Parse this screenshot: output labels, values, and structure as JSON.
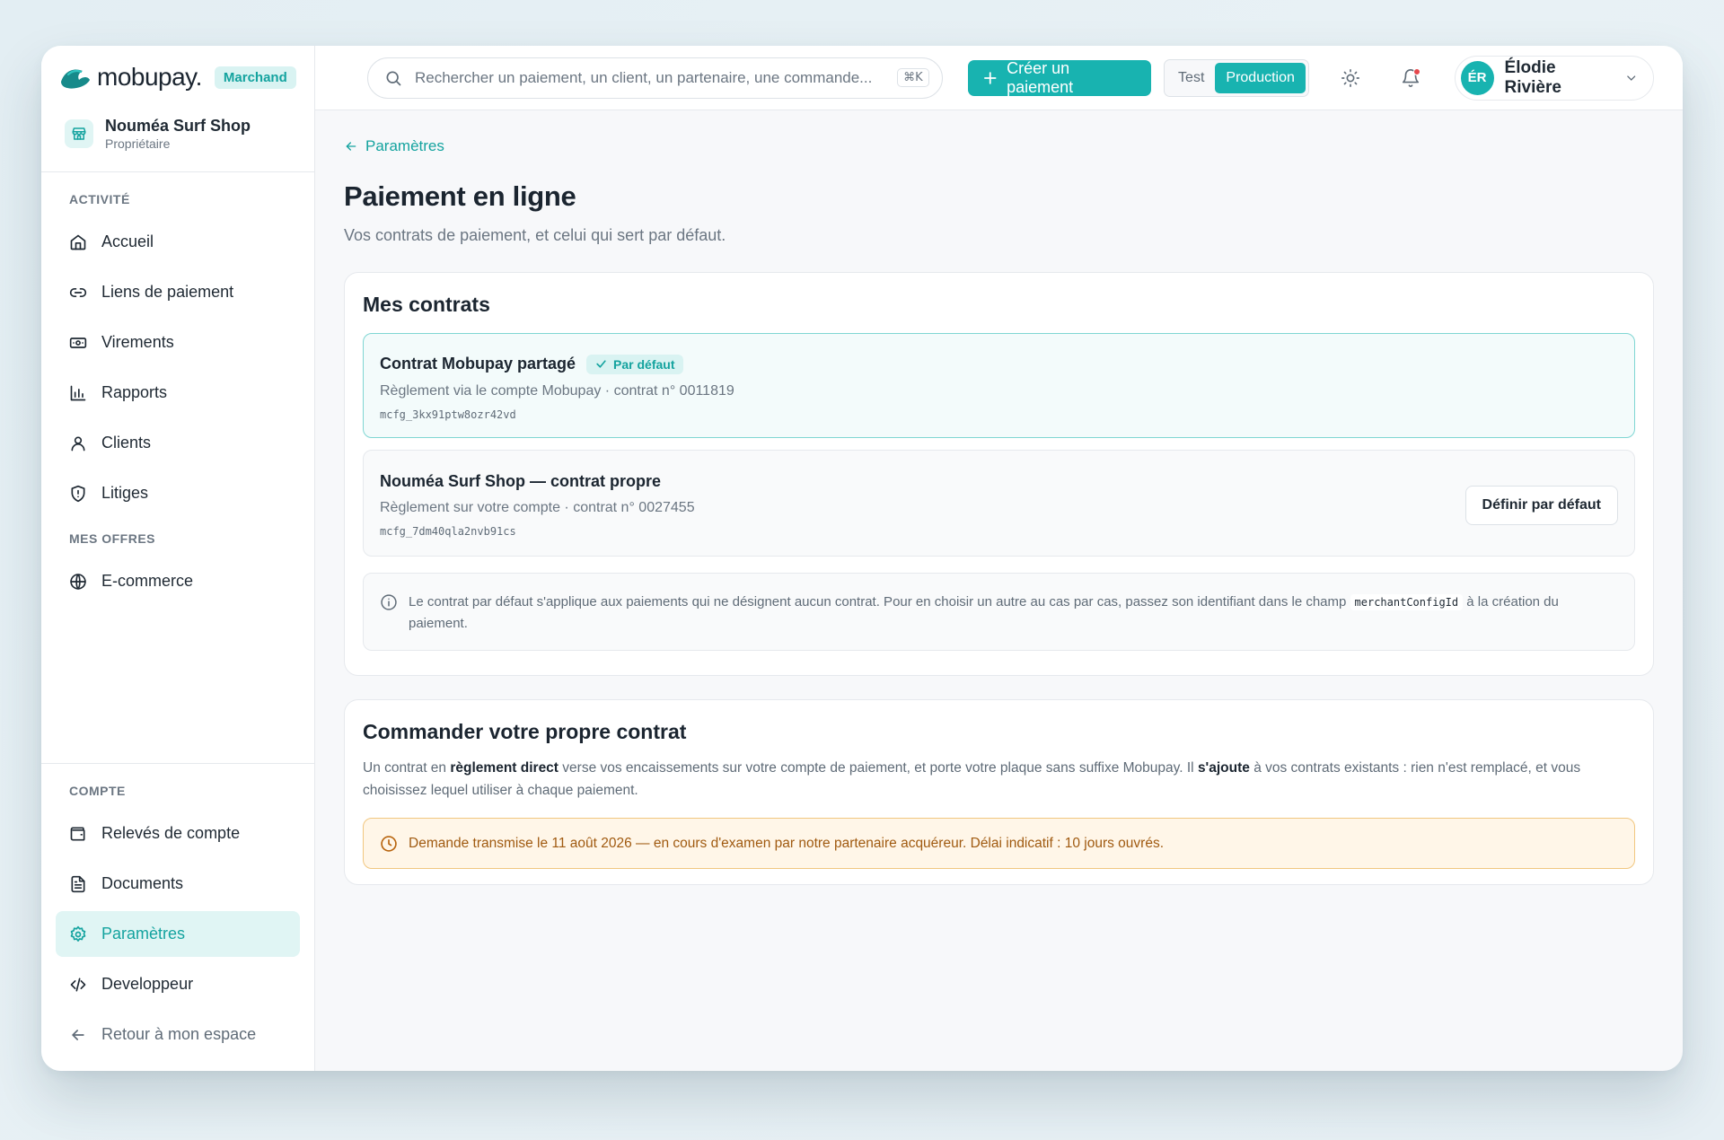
{
  "brand": {
    "logo_text": "mobupay.",
    "role_badge": "Marchand"
  },
  "shop": {
    "name": "Nouméa Surf Shop",
    "role": "Propriétaire"
  },
  "sidebar": {
    "section_activity": "ACTIVITÉ",
    "activity_items": [
      {
        "label": "Accueil",
        "icon": "home-icon"
      },
      {
        "label": "Liens de paiement",
        "icon": "link-icon"
      },
      {
        "label": "Virements",
        "icon": "banknote-icon"
      },
      {
        "label": "Rapports",
        "icon": "bar-chart-icon"
      },
      {
        "label": "Clients",
        "icon": "user-icon"
      },
      {
        "label": "Litiges",
        "icon": "shield-alert-icon"
      }
    ],
    "section_offers": "MES OFFRES",
    "offer_items": [
      {
        "label": "E-commerce",
        "icon": "globe-icon"
      }
    ],
    "section_account": "COMPTE",
    "account_items": [
      {
        "label": "Relevés de compte",
        "icon": "wallet-icon"
      },
      {
        "label": "Documents",
        "icon": "document-icon"
      },
      {
        "label": "Paramètres",
        "icon": "gear-icon",
        "active": true
      },
      {
        "label": "Developpeur",
        "icon": "code-icon"
      },
      {
        "label": "Retour à mon espace",
        "icon": "arrow-left-icon"
      }
    ]
  },
  "topbar": {
    "search_placeholder": "Rechercher un paiement, un client, un partenaire, une commande...",
    "search_shortcut": "⌘K",
    "create_button": "Créer un paiement",
    "env_test": "Test",
    "env_production": "Production",
    "env_selected": "Production",
    "user_initials": "ÉR",
    "user_name": "Élodie Rivière"
  },
  "page": {
    "back_label": "Paramètres",
    "title": "Paiement en ligne",
    "subtitle": "Vos contrats de paiement, et celui qui sert par défaut."
  },
  "contracts": {
    "title": "Mes contrats",
    "items": [
      {
        "title": "Contrat Mobupay partagé",
        "badge": "Par défaut",
        "description": "Règlement via le compte Mobupay · contrat n° 0011819",
        "id": "mcfg_3kx91ptw8ozr42vd"
      },
      {
        "title": "Nouméa Surf Shop — contrat propre",
        "description": "Règlement sur votre compte · contrat n° 0027455",
        "id": "mcfg_7dm40qla2nvb91cs",
        "action": "Définir par défaut"
      }
    ],
    "info_before": "Le contrat par défaut s'applique aux paiements qui ne désignent aucun contrat. Pour en choisir un autre au cas par cas, passez son identifiant dans le champ",
    "info_code": "merchantConfigId",
    "info_after": "à la création du paiement."
  },
  "order": {
    "title": "Commander votre propre contrat",
    "desc_1": "Un contrat en",
    "desc_bold_1": "règlement direct",
    "desc_2": "verse vos encaissements sur votre compte de paiement, et porte votre plaque sans suffixe Mobupay. Il",
    "desc_bold_2": "s'ajoute",
    "desc_3": "à vos contrats existants : rien n'est remplacé, et vous choisissez lequel utiliser à chaque paiement.",
    "pending": "Demande transmise le 11 août 2026 — en cours d'examen par notre partenaire acquéreur. Délai indicatif : 10 jours ouvrés."
  },
  "colors": {
    "accent": "#18b3b0",
    "accent_soft": "#d9f3f2",
    "warning_bg": "#fff6e8",
    "warning_text": "#a05a10"
  }
}
